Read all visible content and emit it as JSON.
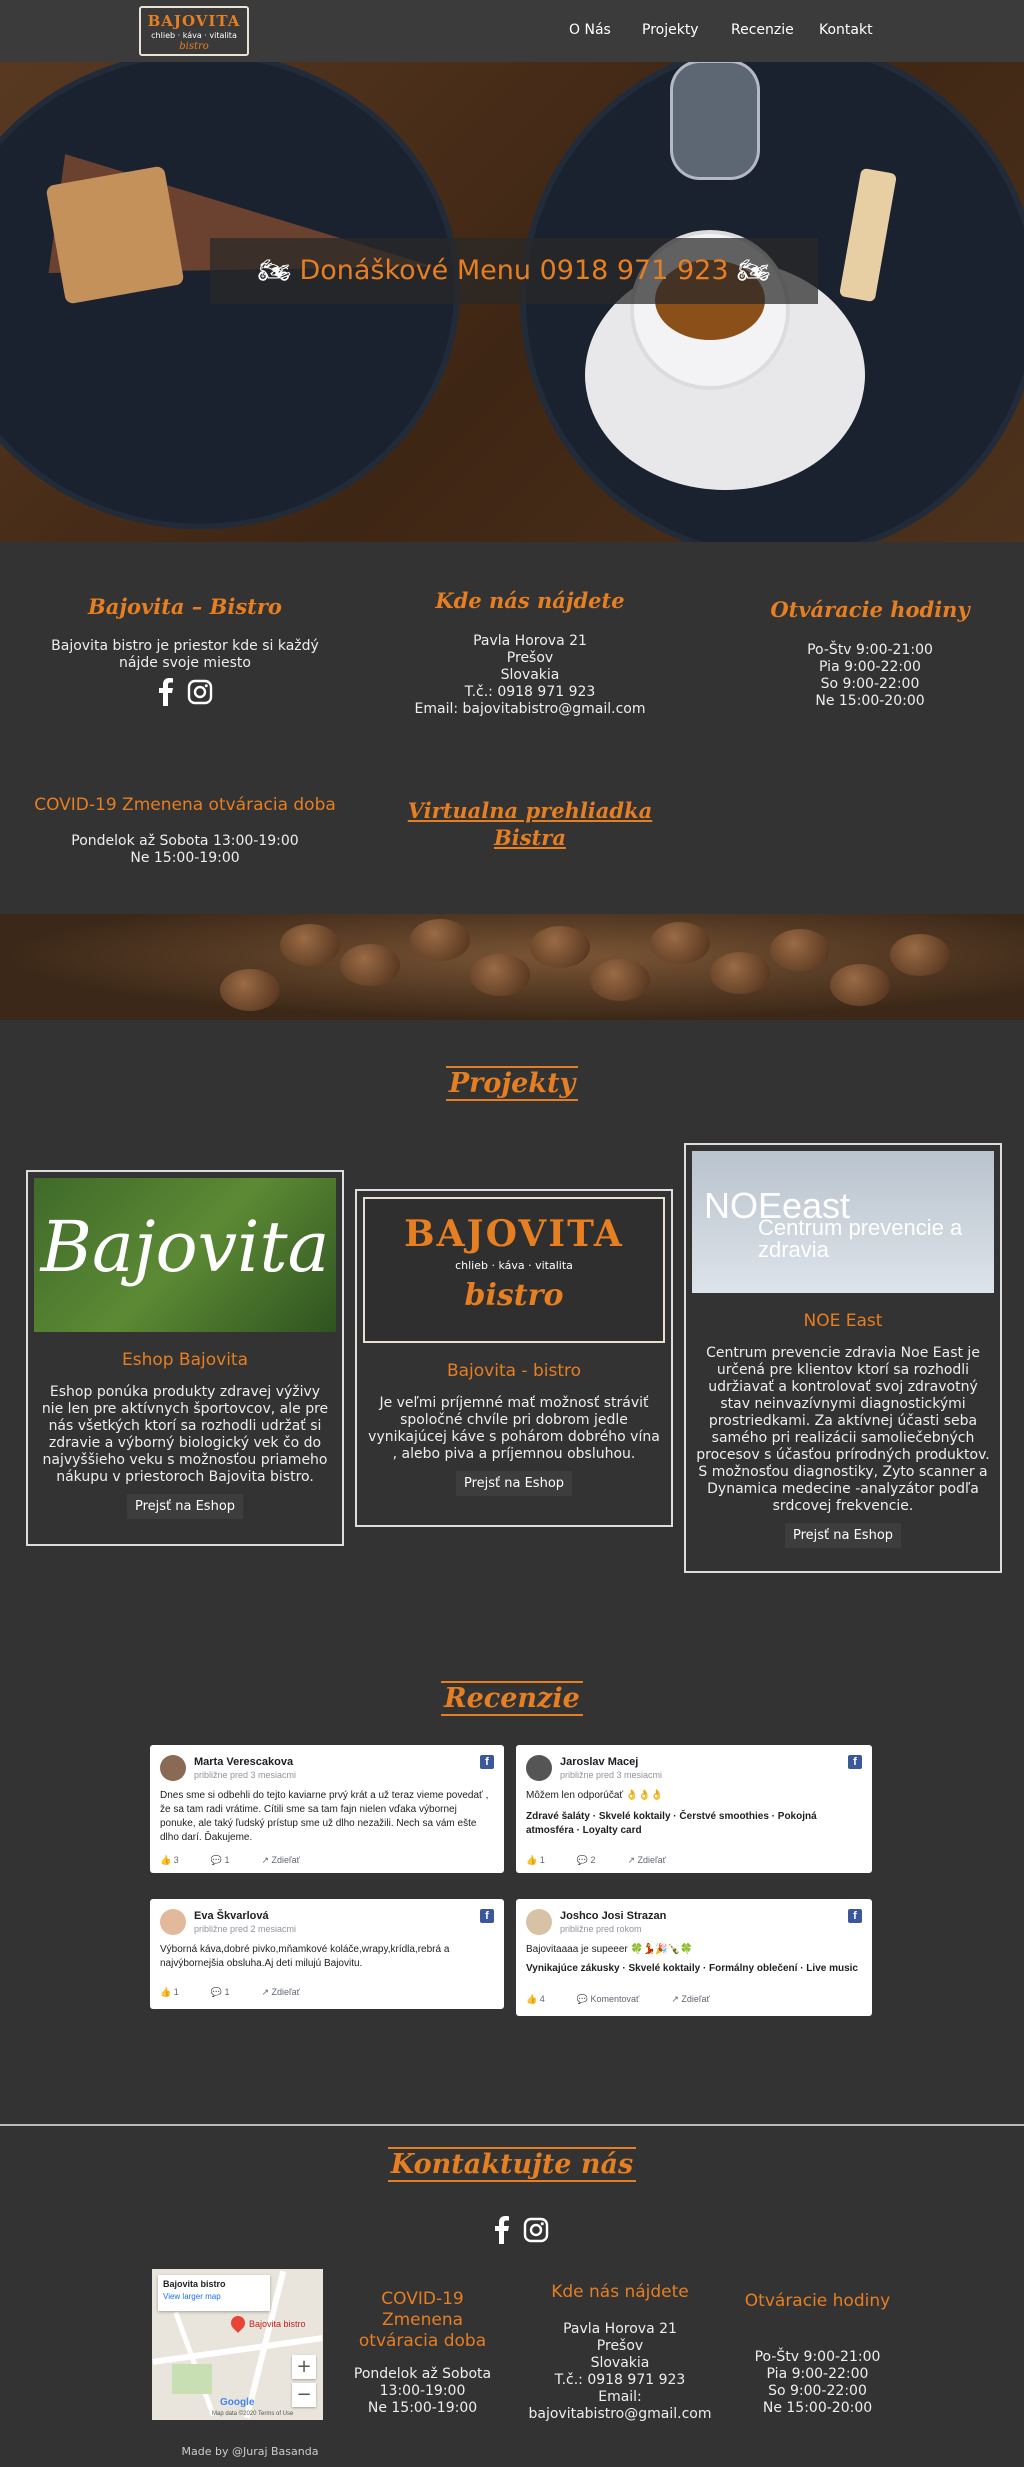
{
  "nav": {
    "logo": {
      "title": "BAJOVITA",
      "tagline": "chlieb · káva · vitalita",
      "sub": "bistro"
    },
    "items": [
      "O Nás",
      "Projekty",
      "Recenzie",
      "Kontakt"
    ]
  },
  "hero": {
    "banner_text": "Donáškové Menu 0918 971 923",
    "icon_left": "motorcycle-icon",
    "icon_right": "motorcycle-icon"
  },
  "info": {
    "about": {
      "title": "Bajovita – Bistro",
      "text": "Bajovita bistro je priestor kde si každý nájde svoje miesto",
      "icons": [
        "facebook-icon",
        "instagram-icon"
      ]
    },
    "location": {
      "title": "Kde nás nájdete",
      "lines": [
        "Pavla Horova 21",
        "Prešov",
        "Slovakia",
        "T.č.: 0918 971 923",
        "Email: bajovitabistro@gmail.com"
      ]
    },
    "hours": {
      "title": "Otváracie hodiny",
      "lines": [
        "Po-Štv 9:00-21:00",
        "Pia 9:00-22:00",
        "So 9:00-22:00",
        "Ne 15:00-20:00"
      ]
    },
    "covid": {
      "title": "COVID-19 Zmenena otváracia doba",
      "lines": [
        "Pondelok až Sobota 13:00-19:00",
        "Ne 15:00-19:00"
      ]
    },
    "virtual": {
      "title": "Virtualna prehliadka Bistra"
    }
  },
  "projects": {
    "title": "Projekty",
    "cards": [
      {
        "image_text": "Bajovita",
        "title": "Eshop Bajovita",
        "text": "Eshop ponúka produkty zdravej výživy nie len pre aktívnych športovcov, ale pre nás všetkých ktorí sa rozhodli udržať si zdravie a výborný biologický vek čo do najvyššieho veku s možnosťou priameho nákupu v priestoroch Bajovita bistro.",
        "button": "Prejsť na Eshop"
      },
      {
        "image_text": "BAJOVITA",
        "image_tagline": "chlieb · káva · vitalita",
        "image_sub": "bistro",
        "title": "Bajovita - bistro",
        "text": "Je veľmi príjemné mať možnosť stráviť spoločné chvíle pri dobrom jedle vynikajúcej káve s pohárom dobrého vína , alebo piva a príjemnou obsluhou.",
        "button": "Prejsť na Eshop"
      },
      {
        "image_text": "NOEeast",
        "image_sub": "Centrum prevencie a zdravia",
        "title": "NOE East",
        "text": "Centrum prevencie zdravia Noe East je určená pre klientov ktorí sa rozhodli udržiavať a kontrolovať svoj zdravotný stav neinvazívnymi diagnostickými prostriedkami. Za aktívnej účasti seba samého pri realizácii samoliečebných procesov s účasťou prírodných produktov. S možnosťou diagnostiky, Zyto scanner a Dynamica medecine -analyzátor podľa srdcovej frekvencie.",
        "button": "Prejsť na Eshop"
      }
    ]
  },
  "reviews": {
    "title": "Recenzie",
    "items": [
      {
        "name": "Marta Verescakova",
        "time": "približne pred 3 mesiacmi",
        "text": "Dnes sme si odbehli do tejto kaviarne prvý krát a už teraz vieme povedať , že sa tam radi vrátime. Cítili sme sa tam fajn nielen vďaka výbornej ponuke, ale taký ľudský prístup sme už dlho nezažili. Nech sa vám ešte dlho darí. Ďakujeme.",
        "tags": "",
        "likes": "3",
        "comments": "1",
        "share": "Zdieľať"
      },
      {
        "name": "Jaroslav Macej",
        "time": "približne pred 3 mesiacmi",
        "text": "Môžem len odporúčať 👌👌👌",
        "tags": "Zdravé šaláty · Skvelé koktaily · Čerstvé smoothies · Pokojná atmosféra · Loyalty card",
        "likes": "1",
        "comments": "2",
        "share": "Zdieľať"
      },
      {
        "name": "Eva Škvarlová",
        "time": "približne pred 2 mesiacmi",
        "text": "Výborná káva,dobré pivko,mňamkové koláče,wrapy,krídla,rebrá a najvýbornejšia obsluha.Aj deti milujú Bajovitu.",
        "tags": "",
        "likes": "1",
        "comments": "1",
        "share": "Zdieľať"
      },
      {
        "name": "Joshco Josi Strazan",
        "time": "približne pred rokom",
        "text": "Bajovitaaaa je supeeer 🍀💃🎉🍾🍀",
        "tags": "Vynikajúce zákusky · Skvelé koktaily · Formálny oblečení · Live music",
        "likes": "4",
        "comments": "Komentovať",
        "share": "Zdieľať"
      }
    ]
  },
  "contact": {
    "title": "Kontaktujte nás",
    "icons": [
      "facebook-icon",
      "instagram-icon"
    ],
    "map": {
      "place": "Bajovita bistro",
      "link": "View larger map",
      "pin_label": "Bajovita bistro",
      "brand": "Google",
      "footer": "Map data ©2020   Terms of Use"
    },
    "covid": {
      "title": "COVID-19 Zmenena otváracia doba",
      "lines": [
        "Pondelok až Sobota",
        "13:00-19:00",
        "Ne 15:00-19:00"
      ]
    },
    "location": {
      "title": "Kde nás nájdete",
      "lines": [
        "Pavla Horova 21",
        "Prešov",
        "Slovakia",
        "T.č.: 0918 971 923",
        "Email:",
        "bajovitabistro@gmail.com"
      ]
    },
    "hours": {
      "title": "Otváracie hodiny",
      "lines": [
        "Po-Štv 9:00-21:00",
        "Pia 9:00-22:00",
        "So 9:00-22:00",
        "Ne 15:00-20:00"
      ]
    }
  },
  "footer": {
    "text": "Made by @Juraj Basanda"
  }
}
